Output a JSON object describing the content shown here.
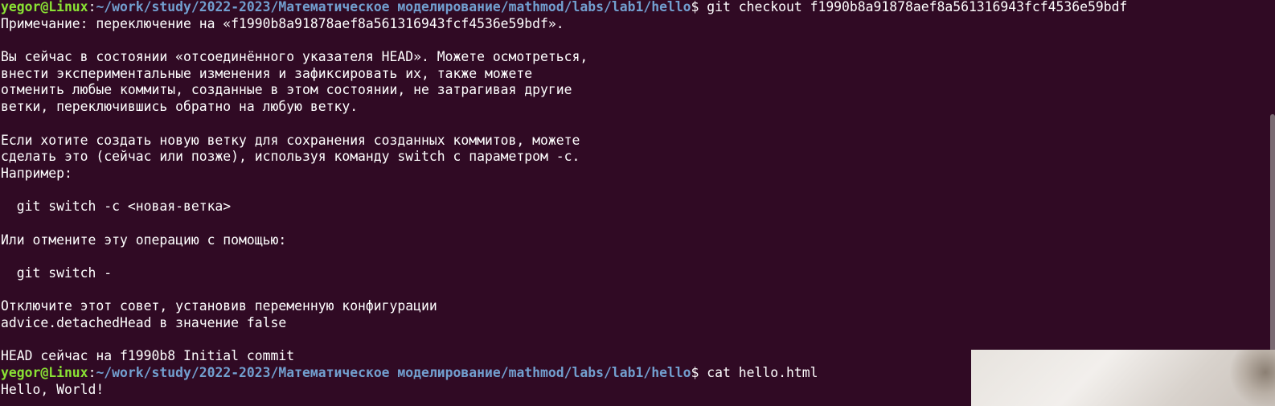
{
  "colors": {
    "background": "#300a24",
    "prompt_user": "#8ae234",
    "prompt_path": "#729fcf",
    "text": "#ffffff"
  },
  "prompt": {
    "user_host": "yegor@Linux",
    "separator": ":",
    "path": "~/work/study/2022-2023/Математическое моделирование/mathmod/labs/lab1/hello",
    "symbol": "$ "
  },
  "commands": {
    "first": "git checkout f1990b8a91878aef8a561316943fcf4536e59bdf",
    "second": "cat hello.html"
  },
  "output_lines": [
    "Примечание: переключение на «f1990b8a91878aef8a561316943fcf4536e59bdf».",
    "",
    "Вы сейчас в состоянии «отсоединённого указателя HEAD». Можете осмотреться,",
    "внести экспериментальные изменения и зафиксировать их, также можете",
    "отменить любые коммиты, созданные в этом состоянии, не затрагивая другие",
    "ветки, переключившись обратно на любую ветку.",
    "",
    "Если хотите создать новую ветку для сохранения созданных коммитов, можете",
    "сделать это (сейчас или позже), используя команду switch с параметром -c.",
    "Например:",
    "",
    "  git switch -c <новая-ветка>",
    "",
    "Или отмените эту операцию с помощью:",
    "",
    "  git switch -",
    "",
    "Отключите этот совет, установив переменную конфигурации",
    "advice.detachedHead в значение false",
    "",
    "HEAD сейчас на f1990b8 Initial commit"
  ],
  "final_output": "Hello, World!"
}
